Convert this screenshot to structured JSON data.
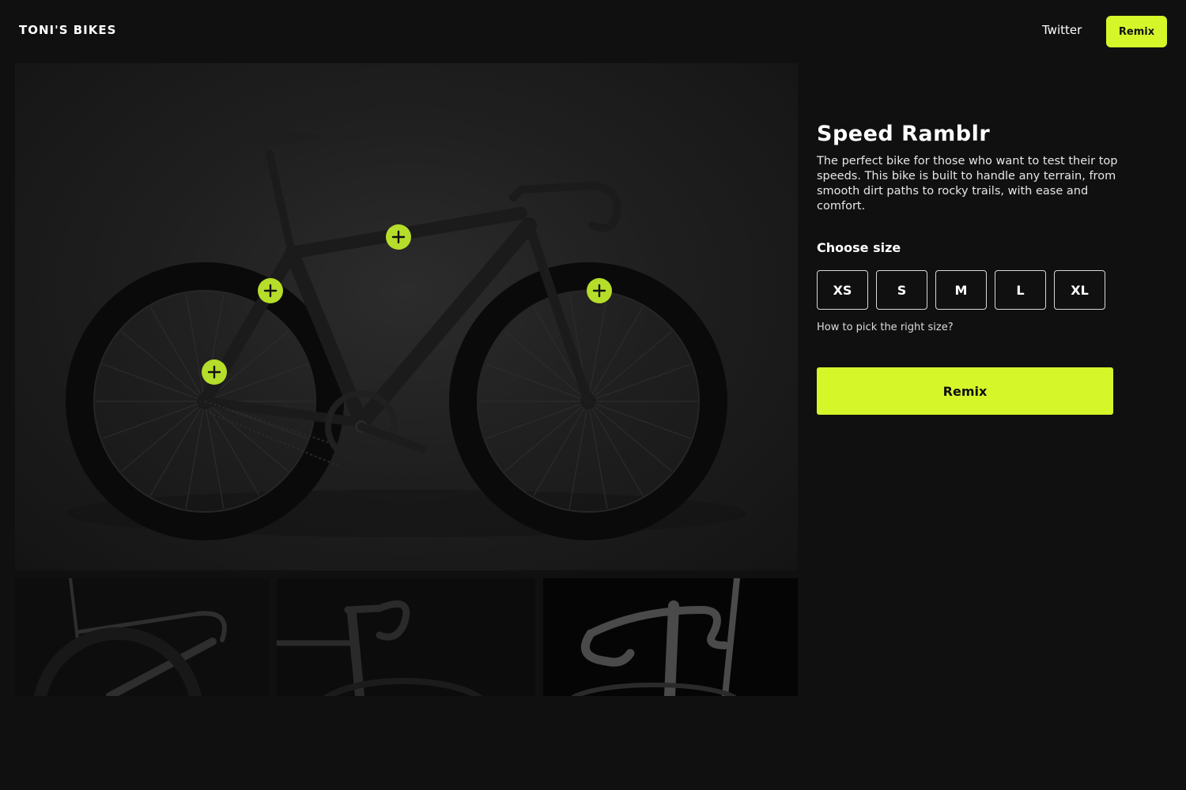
{
  "header": {
    "brand": "TONI'S BIKES",
    "nav_link": "Twitter",
    "button_label": "Remix"
  },
  "product": {
    "title": "Speed Ramblr",
    "description": "The perfect bike for those who want to test their top speeds. This bike is built to handle any terrain, from smooth dirt paths to rocky trails, with ease and comfort.",
    "size_label": "Choose size",
    "sizes": [
      "XS",
      "S",
      "M",
      "L",
      "XL"
    ],
    "size_help": "How to pick the right size?",
    "cta_label": "Remix"
  },
  "hotspot_icon": "plus-icon",
  "colors": {
    "accent": "#d5f72a",
    "hotspot": "#b5dd2a",
    "background": "#101010"
  }
}
